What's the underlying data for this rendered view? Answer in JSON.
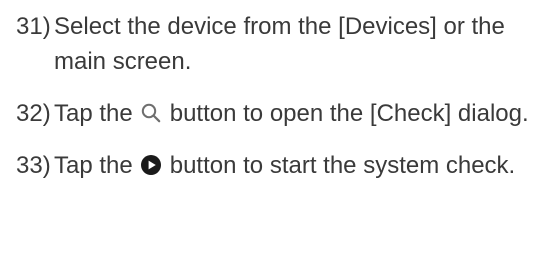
{
  "steps": [
    {
      "number": "31)",
      "text": "Select the device from the [Devices] or the main screen."
    },
    {
      "number": "32)",
      "text_before": "Tap the",
      "icon": "search-icon",
      "text_after": "button to open the [Check] dialog."
    },
    {
      "number": "33)",
      "text_before": "Tap the",
      "icon": "play-circle-icon",
      "text_after": "button to start the system check."
    }
  ],
  "colors": {
    "text": "#3a3a3a",
    "icon_outline": "#6f6f6f",
    "icon_fill": "#1a1a1a"
  }
}
